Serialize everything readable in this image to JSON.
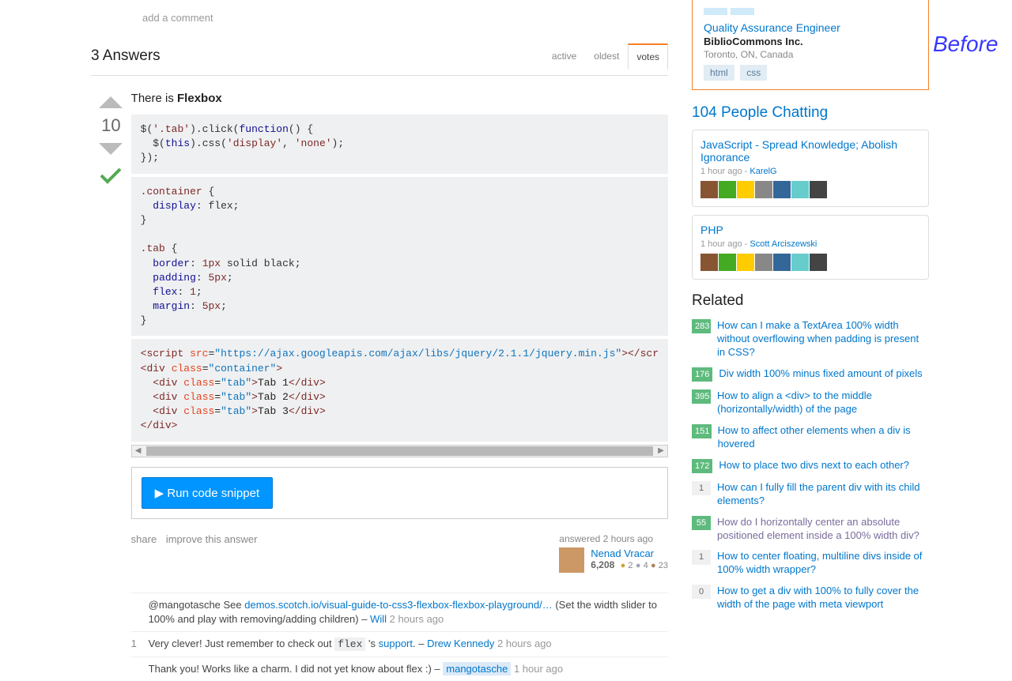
{
  "add_comment": "add a comment",
  "answers_count": "3 Answers",
  "tabs": {
    "active": "active",
    "oldest": "oldest",
    "votes": "votes"
  },
  "answer": {
    "intro_prefix": "There is ",
    "intro_bold": "Flexbox",
    "votes": "10",
    "run_snippet": "▶ Run code snippet",
    "share": "share",
    "improve": "improve this answer",
    "answered": "answered 2 hours ago",
    "user": "Nenad Vracar",
    "rep": "6,208",
    "gold": "2",
    "silver": "4",
    "bronze": "23"
  },
  "comments": [
    {
      "score": "",
      "body_prefix": "@mangotasche See ",
      "link": "demos.scotch.io/visual-guide-to-css3-flexbox-flexbox-playground/…",
      "body_suffix": " (Set the width slider to 100% and play with removing/adding children) – ",
      "author": "Will",
      "time": "2 hours ago",
      "owner": false
    },
    {
      "score": "1",
      "body_prefix": "Very clever! Just remember to check out ",
      "code": "flex",
      "body_mid": " 's ",
      "link": "support",
      "body_suffix": ". – ",
      "author": "Drew Kennedy",
      "time": "2 hours ago",
      "owner": false
    },
    {
      "score": "",
      "body_prefix": "Thank you! Works like a charm. I did not yet know about flex :) – ",
      "author": "mangotasche",
      "time": "1 hour ago",
      "owner": true
    }
  ],
  "job": {
    "title": "Quality Assurance Engineer",
    "company": "BiblioCommons Inc.",
    "location": "Toronto, ON, Canada",
    "tags": [
      "html",
      "css"
    ]
  },
  "chat_header": "104 People Chatting",
  "chat_rooms": [
    {
      "title": "JavaScript - Spread Knowledge; Abolish Ignorance",
      "meta_time": "1 hour ago",
      "meta_user": "KarelG",
      "avatars": 7
    },
    {
      "title": "PHP",
      "meta_time": "1 hour ago",
      "meta_user": "Scott Arciszewski",
      "avatars": 7
    }
  ],
  "related_header": "Related",
  "related": [
    {
      "votes": "283",
      "answered": true,
      "text": "How can I make a TextArea 100% width without overflowing when padding is present in CSS?",
      "visited": false
    },
    {
      "votes": "176",
      "answered": true,
      "text": "Div width 100% minus fixed amount of pixels",
      "visited": false
    },
    {
      "votes": "395",
      "answered": true,
      "text": "How to align a <div> to the middle (horizontally/width) of the page",
      "visited": false
    },
    {
      "votes": "151",
      "answered": true,
      "text": "How to affect other elements when a div is hovered",
      "visited": false
    },
    {
      "votes": "172",
      "answered": true,
      "text": "How to place two divs next to each other?",
      "visited": false
    },
    {
      "votes": "1",
      "answered": false,
      "text": "How can I fully fill the parent div with its child elements?",
      "visited": false
    },
    {
      "votes": "55",
      "answered": true,
      "text": "How do I horizontally center an absolute positioned element inside a 100% width div?",
      "visited": true
    },
    {
      "votes": "1",
      "answered": false,
      "text": "How to center floating, multiline divs inside of 100% width wrapper?",
      "visited": false
    },
    {
      "votes": "0",
      "answered": false,
      "text": "How to get a div with 100% to fully cover the width of the page with meta viewport",
      "visited": false
    }
  ],
  "before_label": "Before"
}
